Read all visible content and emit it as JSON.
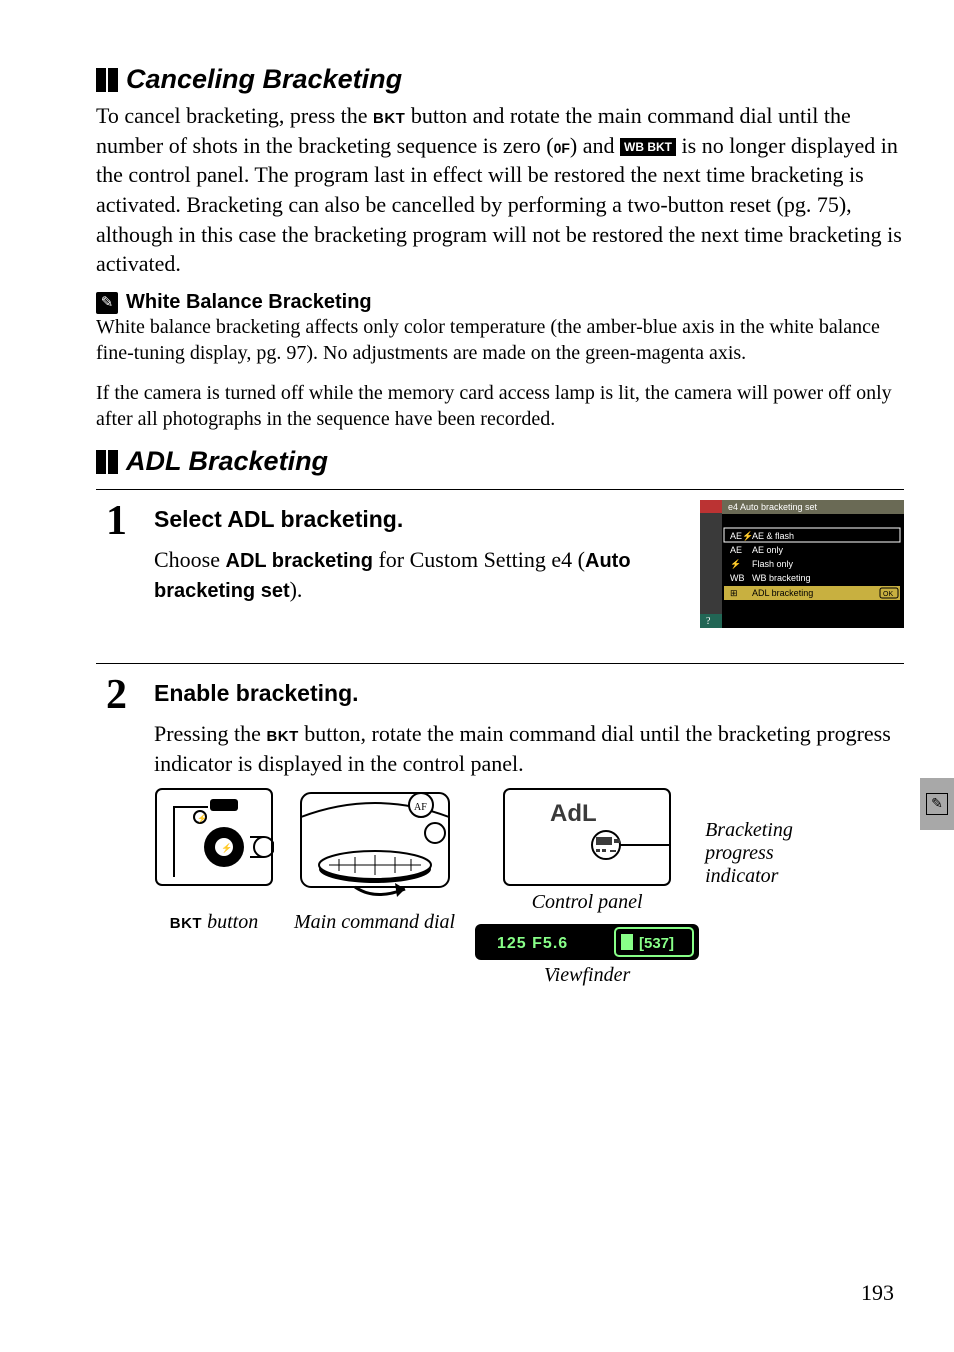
{
  "section1": {
    "title": "Canceling Bracketing",
    "body_pre": "To cancel bracketing, press the ",
    "body_mid1": " button and rotate the main command dial until the number of shots in the bracketing sequence is zero (",
    "zeroF": "0F",
    "body_mid2": ") and ",
    "wbbkt": "WB BKT",
    "body_post": " is no longer displayed in the control panel.  The program last in effect will be restored the next time bracketing is activated.  Bracketing can also be cancelled by performing a two-button reset (pg. 75), although in this case the bracketing program will not be restored the next time bracketing is activated."
  },
  "note": {
    "title": "White Balance Bracketing",
    "p1": "White balance bracketing affects only color temperature (the amber-blue axis in the white balance fine-tuning display, pg. 97).  No adjustments are made on the green-magenta axis.",
    "p2": "If the camera is turned off while the memory card access lamp is lit, the camera will power off only after all photographs in the sequence have been recorded."
  },
  "section2": {
    "title": "ADL Bracketing"
  },
  "step1": {
    "num": "1",
    "title": "Select ADL bracketing.",
    "para_pre": "Choose ",
    "para_b1": "ADL bracketing",
    "para_mid": " for Custom Setting e4 (",
    "para_b2": "Auto bracketing set",
    "para_post": ")."
  },
  "menu": {
    "header": "e4 Auto bracketing set",
    "items": [
      {
        "code": "AE⚡",
        "label": "AE & flash"
      },
      {
        "code": "AE",
        "label": "AE only"
      },
      {
        "code": "⚡",
        "label": "Flash only"
      },
      {
        "code": "WB",
        "label": "WB bracketing"
      },
      {
        "code": "⊞",
        "label": "ADL bracketing"
      }
    ],
    "ok": "OK"
  },
  "step2": {
    "num": "2",
    "title": "Enable bracketing.",
    "para_pre": "Pressing the ",
    "para_post": " button, rotate the main command dial until the bracketing progress indicator is displayed in the control panel."
  },
  "captions": {
    "bkt_btn": " button",
    "bkt_label": "BKT",
    "main_dial": "Main command dial",
    "control_panel": "Control panel",
    "viewfinder": "Viewfinder",
    "indicator": "Bracketing progress indicator"
  },
  "lcd": {
    "adl": "AdL",
    "vf": "125  F5.6",
    "vf_right": "[537]"
  },
  "bkt_glyph": "BKT",
  "page_number": "193"
}
